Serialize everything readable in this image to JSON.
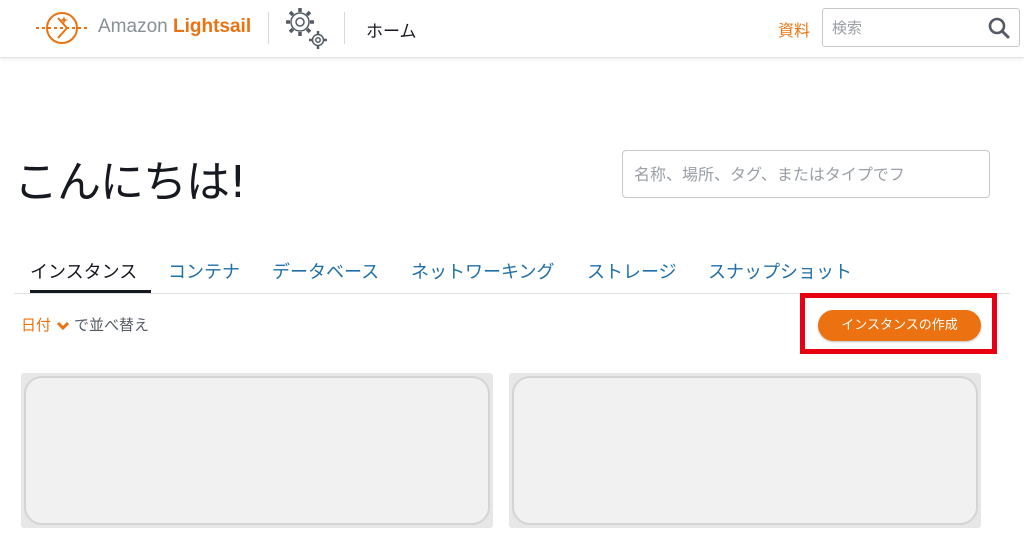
{
  "app": {
    "logo_prefix": "Amazon",
    "logo_brand": "Lightsail",
    "brand_color": "#ec7211"
  },
  "header": {
    "home_label": "ホーム",
    "docs_label": "資料",
    "search_placeholder": "検索",
    "search_icon": "search-icon",
    "settings_icon": "gear-icon"
  },
  "main": {
    "greeting": "こんにちは!",
    "filter_placeholder": "名称、場所、タグ、またはタイプでフ",
    "tabs": [
      {
        "label": "インスタンス",
        "active": true
      },
      {
        "label": "コンテナ",
        "active": false
      },
      {
        "label": "データベース",
        "active": false
      },
      {
        "label": "ネットワーキング",
        "active": false
      },
      {
        "label": "ストレージ",
        "active": false
      },
      {
        "label": "スナップショット",
        "active": false
      }
    ],
    "sort": {
      "key": "日付",
      "suffix": "で並べ替え",
      "icon": "chevron-down-icon"
    },
    "create_button": "インスタンスの作成",
    "highlight_color": "#e60012"
  }
}
